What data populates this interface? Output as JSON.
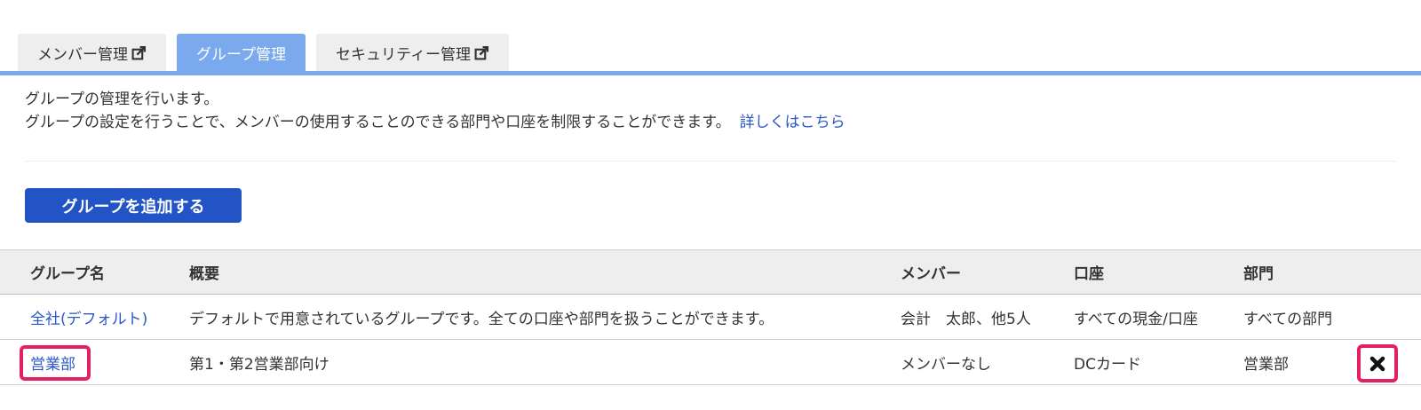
{
  "tabs": [
    {
      "label": "メンバー管理",
      "external": true
    },
    {
      "label": "グループ管理",
      "external": false
    },
    {
      "label": "セキュリティー管理",
      "external": true
    }
  ],
  "description": {
    "line1": "グループの管理を行います。",
    "line2": "グループの設定を行うことで、メンバーの使用することのできる部門や口座を制限することができます。",
    "link": "詳しくはこちら"
  },
  "add_button": "グループを追加する",
  "table": {
    "headers": [
      "グループ名",
      "概要",
      "メンバー",
      "口座",
      "部門"
    ],
    "rows": [
      {
        "name": "全社(デフォルト)",
        "desc": "デフォルトで用意されているグループです。全ての口座や部門を扱うことができます。",
        "members": "会計　太郎、他5人",
        "account": "すべての現金/口座",
        "dept": "すべての部門"
      },
      {
        "name": "営業部",
        "desc": "第1・第2営業部向け",
        "members": "メンバーなし",
        "account": "DCカード",
        "dept": "営業部"
      }
    ]
  },
  "colors": {
    "accent": "#7aa9ee",
    "button": "#2254c6",
    "link": "#2a56c6",
    "highlight": "#e5205f"
  }
}
